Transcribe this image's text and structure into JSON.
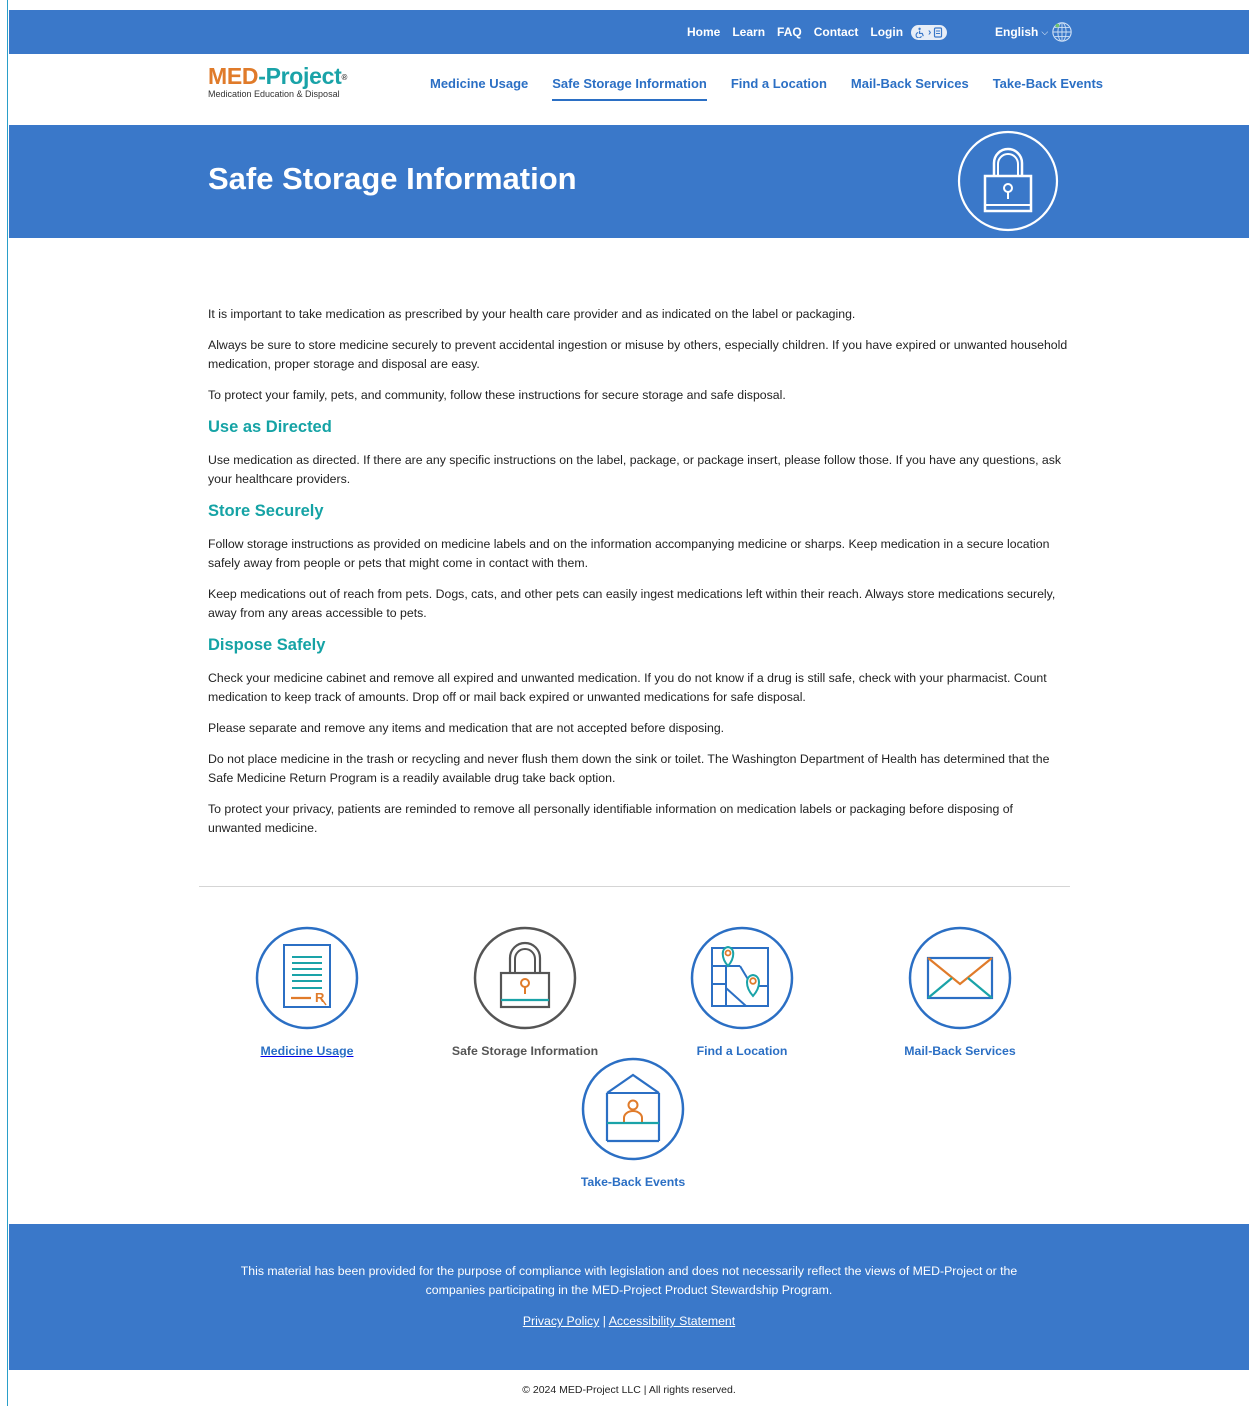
{
  "topnav": {
    "home": "Home",
    "learn": "Learn",
    "faq": "FAQ",
    "contact": "Contact",
    "login": "Login",
    "language": "English"
  },
  "logo": {
    "med": "MED",
    "dash_project": "-Project",
    "reg": "®",
    "tagline": "Medication Education & Disposal"
  },
  "mainnav": [
    {
      "label": "Medicine Usage",
      "active": false
    },
    {
      "label": "Safe Storage Information",
      "active": true
    },
    {
      "label": "Find a Location",
      "active": false
    },
    {
      "label": "Mail-Back Services",
      "active": false
    },
    {
      "label": "Take-Back Events",
      "active": false
    }
  ],
  "hero": {
    "title": "Safe Storage Information"
  },
  "content": {
    "intro1": "It is important to take medication as prescribed by your health care provider and as indicated on the label or packaging.",
    "intro2": "Always be sure to store medicine securely to prevent accidental ingestion or misuse by others, especially children. If you have expired or unwanted household medication, proper storage and disposal are easy.",
    "intro3": "To protect your family, pets, and community, follow these instructions for secure storage and safe disposal.",
    "h_use": "Use as Directed",
    "use1": "Use medication as directed. If there are any specific instructions on the label, package, or package insert, please follow those. If you have any questions, ask your healthcare providers.",
    "h_store": "Store Securely",
    "store1": "Follow storage instructions as provided on medicine labels and on the information accompanying medicine or sharps. Keep medication in a secure location safely away from people or pets that might come in contact with them.",
    "store2": "Keep medications out of reach from pets. Dogs, cats, and other pets can easily ingest medications left within their reach. Always store medications securely, away from any areas accessible to pets.",
    "h_dispose": "Dispose Safely",
    "dispose1": "Check your medicine cabinet and remove all expired and unwanted medication. If you do not know if a drug is still safe, check with your pharmacist. Count medication to keep track of amounts. Drop off or mail back expired or unwanted medications for safe disposal.",
    "dispose2": "Please separate and remove any items and medication that are not accepted before disposing.",
    "dispose3": "Do not place medicine in the trash or recycling and never flush them down the sink or toilet. The Washington Department of Health has determined that the Safe Medicine Return Program is a readily available drug take back option.",
    "dispose4": "To protect your privacy, patients are reminded to remove all personally identifiable information on medication labels or packaging before disposing of unwanted medicine."
  },
  "cards": [
    {
      "label": "Medicine Usage",
      "icon": "prescription-document-icon"
    },
    {
      "label": "Safe Storage Information",
      "icon": "padlock-icon"
    },
    {
      "label": "Find a Location",
      "icon": "map-pin-icon"
    },
    {
      "label": "Mail-Back Services",
      "icon": "envelope-icon"
    },
    {
      "label": "Take-Back Events",
      "icon": "kiosk-person-icon"
    }
  ],
  "footer": {
    "disclaimer": "This material has been provided for the purpose of compliance with legislation and does not necessarily reflect the views of MED-Project or the companies participating in the MED-Project Product Stewardship Program.",
    "privacy": "Privacy Policy",
    "sep": "|",
    "accessibility": "Accessibility Statement",
    "copyright": "© 2024 MED-Project LLC | All rights reserved."
  },
  "colors": {
    "brand_blue": "#3a78c9",
    "link_blue": "#2b6fc4",
    "teal": "#15a3a5",
    "orange": "#e07b2a"
  }
}
